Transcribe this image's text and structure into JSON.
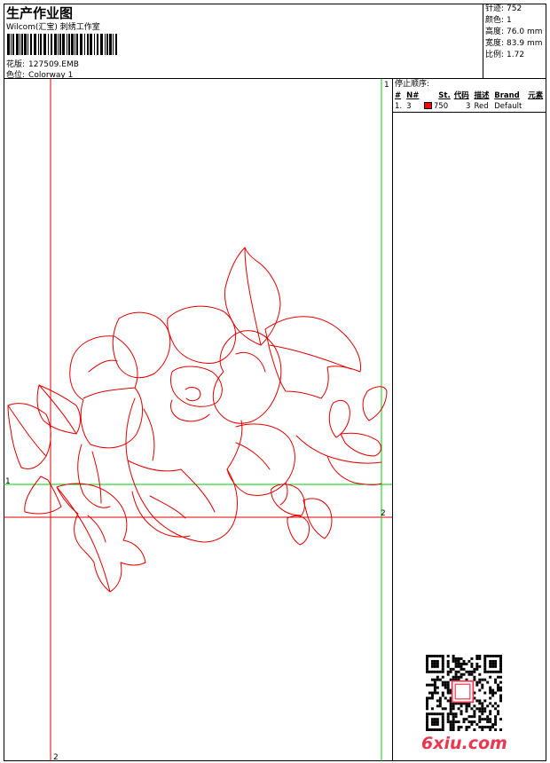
{
  "header": {
    "title": "生产作业图",
    "company": "Wilcom(汇宝)  刺绣工作室",
    "design_label": "花版:",
    "design_value": "127509.EMB",
    "colorway_label": "色位:",
    "colorway_value": "Colorway 1"
  },
  "stats": [
    {
      "label": "针迹:",
      "value": "752"
    },
    {
      "label": "颜色:",
      "value": "1"
    },
    {
      "label": "高度:",
      "value": "76.0 mm"
    },
    {
      "label": "宽度:",
      "value": "83.9 mm"
    },
    {
      "label": "比例:",
      "value": "1.72"
    }
  ],
  "stop_sequence": {
    "title": "停止顺序:",
    "columns": [
      "#",
      "N#",
      "St.",
      "代码",
      "描述",
      "Brand",
      "元素"
    ],
    "rows": [
      {
        "index": "1.",
        "needle": "3",
        "swatch_color": "#ff0000",
        "stitches": "750",
        "code": "3",
        "description": "Red",
        "brand": "Default",
        "element": ""
      }
    ]
  },
  "guides": {
    "h1": "1",
    "h2": "2",
    "v1": "1",
    "v2": "2"
  },
  "colors": {
    "stitch": "#e00000",
    "guide_green": "#00cc00",
    "guide_red": "#e00000"
  },
  "watermark": "6xiu.com"
}
